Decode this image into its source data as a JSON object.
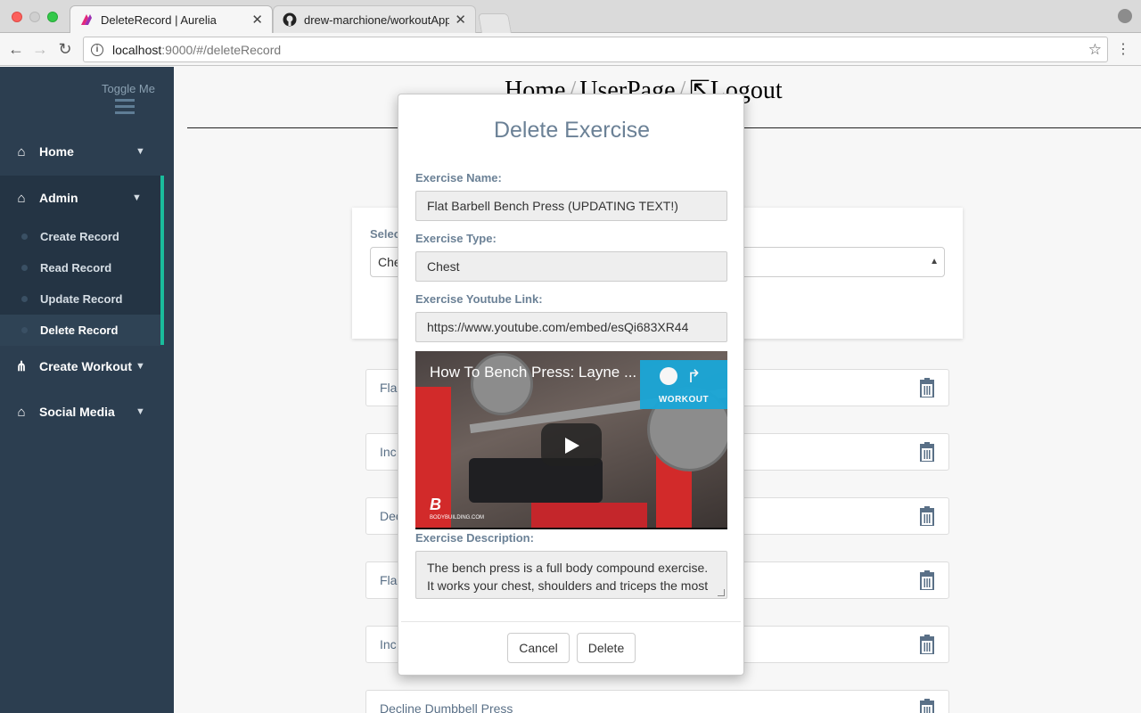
{
  "browser": {
    "tabs": [
      {
        "title": "DeleteRecord | Aurelia",
        "favicon": "aurelia-icon",
        "active": true
      },
      {
        "title": "drew-marchione/workoutApp",
        "favicon": "github-icon",
        "active": false
      }
    ],
    "url_host": "localhost",
    "url_rest": ":9000/#/deleteRecord"
  },
  "sidebar": {
    "toggle_label": "Toggle Me",
    "items": [
      {
        "label": "Home",
        "icon": "home-icon"
      },
      {
        "label": "Admin",
        "icon": "home-icon"
      },
      {
        "label": "Create Workout",
        "icon": "sitemap-icon"
      },
      {
        "label": "Social Media",
        "icon": "home-icon"
      }
    ],
    "admin_sub": [
      {
        "label": "Create Record"
      },
      {
        "label": "Read Record"
      },
      {
        "label": "Update Record"
      },
      {
        "label": "Delete Record",
        "current": true
      }
    ]
  },
  "topnav": {
    "home": "Home",
    "userpage": "UserPage",
    "logout": "Logout"
  },
  "select_panel": {
    "label": "Selec",
    "value": "Che"
  },
  "exercise_rows": [
    {
      "name": "Fla"
    },
    {
      "name": "Inc"
    },
    {
      "name": "Dec"
    },
    {
      "name": "Fla"
    },
    {
      "name": "Inc"
    },
    {
      "name": "Decline Dumbbell Press"
    }
  ],
  "modal": {
    "title": "Delete Exercise",
    "name_label": "Exercise Name:",
    "name_value": "Flat Barbell Bench Press (UPDATING TEXT!)",
    "type_label": "Exercise Type:",
    "type_value": "Chest",
    "link_label": "Exercise Youtube Link:",
    "link_value": "https://www.youtube.com/embed/esQi683XR44",
    "video": {
      "title": "How To Bench Press: Layne ...",
      "watch_later": "WORKOUT",
      "logo": "B",
      "logo_sub": "BODYBUILDING.COM"
    },
    "description_label": "Exercise Description:",
    "description_value": "The bench press is a full body compound exercise. It works your chest, shoulders and triceps the most with the most effective amount...",
    "cancel_label": "Cancel",
    "delete_label": "Delete"
  },
  "colors": {
    "sidebar_bg": "#2c3e50",
    "accent": "#1abc9c",
    "label_color": "#6b8196"
  }
}
